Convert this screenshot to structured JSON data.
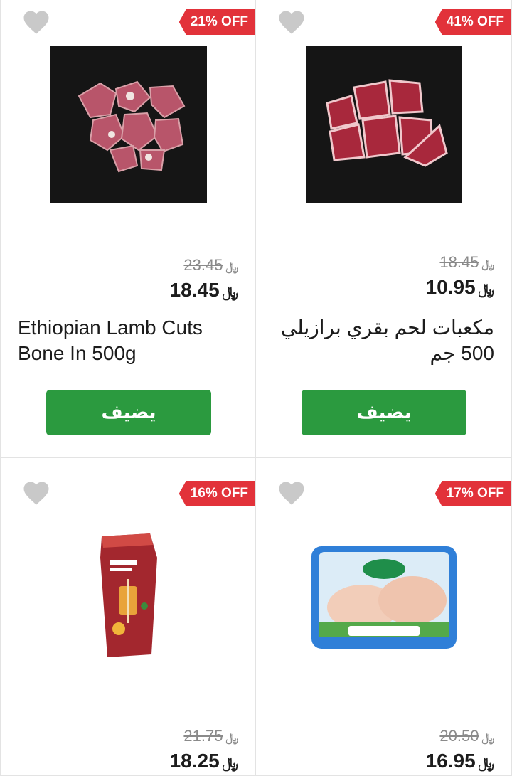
{
  "currency_symbol": "﷼",
  "products": [
    {
      "discount": "21% OFF",
      "old_price": "23.45",
      "price": "18.45",
      "title": "Ethiopian Lamb Cuts Bone In 500g",
      "add_label": "يضيف",
      "image": "lamb-cuts-on-dark-background"
    },
    {
      "discount": "41% OFF",
      "old_price": "18.45",
      "price": "10.95",
      "title": "مكعبات لحم بقري برازيلي 500 جم",
      "add_label": "يضيف",
      "image": "beef-cubes-on-dark-background"
    },
    {
      "discount": "16% OFF",
      "old_price": "21.75",
      "price": "18.25",
      "image": "shish-tawook-pack"
    },
    {
      "discount": "17% OFF",
      "old_price": "20.50",
      "price": "16.95",
      "image": "alyoum-chicken-legs-tray"
    }
  ],
  "colors": {
    "discount_badge": "#e2323a",
    "add_button": "#2b9a3f",
    "heart": "#c9c9c9"
  }
}
